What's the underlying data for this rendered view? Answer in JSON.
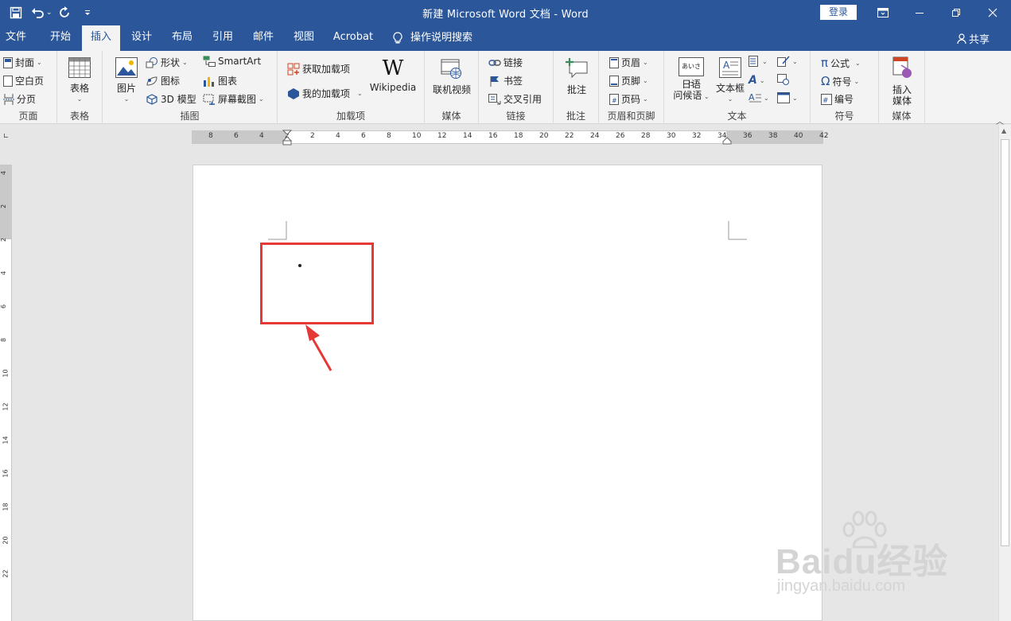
{
  "window": {
    "title": "新建 Microsoft Word 文档  -  Word",
    "login_label": "登录"
  },
  "tabs": [
    {
      "label": "文件"
    },
    {
      "label": "开始"
    },
    {
      "label": "插入",
      "active": true
    },
    {
      "label": "设计"
    },
    {
      "label": "布局"
    },
    {
      "label": "引用"
    },
    {
      "label": "邮件"
    },
    {
      "label": "视图"
    },
    {
      "label": "Acrobat"
    }
  ],
  "tell_me": "操作说明搜索",
  "share_label": "共享",
  "ribbon": {
    "pages": {
      "label": "页面",
      "cover": "封面",
      "blank": "空白页",
      "break": "分页"
    },
    "tables": {
      "label": "表格",
      "table": "表格"
    },
    "illustrations": {
      "label": "插图",
      "picture": "图片",
      "shapes": "形状",
      "icons": "图标",
      "model3d": "3D 模型",
      "smartart": "SmartArt",
      "chart": "图表",
      "screenshot": "屏幕截图"
    },
    "addins": {
      "label": "加载项",
      "get": "获取加载项",
      "my": "我的加载项",
      "wikipedia": "Wikipedia"
    },
    "media": {
      "label": "媒体",
      "online_video": "联机视频"
    },
    "links": {
      "label": "链接",
      "link": "链接",
      "bookmark": "书签",
      "crossref": "交叉引用"
    },
    "comments": {
      "label": "批注",
      "comment": "批注"
    },
    "header_footer": {
      "label": "页眉和页脚",
      "header": "页眉",
      "footer": "页脚",
      "page_number": "页码"
    },
    "text": {
      "label": "文本",
      "japanese_line1": "日语",
      "japanese_line2": "问候语",
      "textbox": "文本框",
      "greeting_icon_text": "あいさつ"
    },
    "symbols": {
      "label": "符号",
      "equation": "公式",
      "symbol": "符号",
      "numbering": "编号"
    },
    "insert_media": {
      "label": "媒体",
      "line1": "插入",
      "line2": "媒体"
    }
  },
  "ruler": {
    "h_ticks": [
      "8",
      "6",
      "4",
      "2",
      "2",
      "4",
      "6",
      "8",
      "10",
      "12",
      "14",
      "16",
      "18",
      "20",
      "22",
      "24",
      "26",
      "28",
      "30",
      "32",
      "34",
      "36",
      "38",
      "40",
      "42"
    ],
    "v_ticks": [
      "4",
      "2",
      "2",
      "4",
      "6",
      "8",
      "10",
      "12",
      "14",
      "16",
      "18",
      "20",
      "22"
    ]
  },
  "watermark": {
    "brand": "Bai",
    "brand_suffix": "du经验",
    "url": "jingyan.baidu.com"
  },
  "colors": {
    "accent": "#2b579a",
    "highlight": "#e53935"
  }
}
